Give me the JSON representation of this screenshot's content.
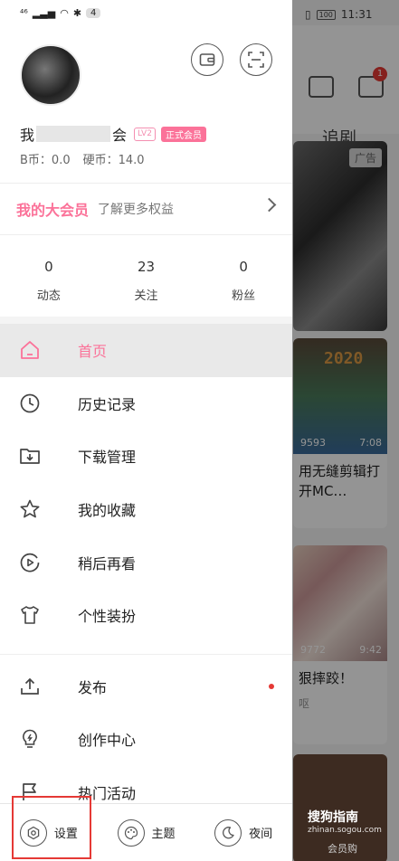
{
  "statusbar": {
    "signal": "⁴⁶",
    "notif_count": "4",
    "battery": "100",
    "time": "11:31"
  },
  "background": {
    "tab_label": "追剧",
    "mail_badge": "1",
    "ad_label": "广告",
    "card2": {
      "overlay_text": "2020",
      "views": "9593",
      "duration": "7:08",
      "title": "用无缝剪辑打开MC…"
    },
    "card3": {
      "views": "9772",
      "duration": "9:42",
      "title": "狠摔跤！",
      "sub": "呕"
    },
    "footer_label": "会员购",
    "watermark": "搜狗指南",
    "watermark_url": "zhinan.sogou.com"
  },
  "profile": {
    "name_start": "我",
    "name_end": "会",
    "level": "LV2",
    "vip_badge": "正式会员",
    "bcoin": "B币：0.0",
    "hardcoin": "硬币：14.0"
  },
  "vip_banner": {
    "title": "我的大会员",
    "subtitle": "了解更多权益"
  },
  "stats": [
    {
      "value": "0",
      "label": "动态"
    },
    {
      "value": "23",
      "label": "关注"
    },
    {
      "value": "0",
      "label": "粉丝"
    }
  ],
  "menu": {
    "home": "首页",
    "history": "历史记录",
    "downloads": "下载管理",
    "favorites": "我的收藏",
    "watch_later": "稍后再看",
    "theme_store": "个性装扮",
    "publish": "发布",
    "creator_center": "创作中心",
    "hot_events": "热门活动"
  },
  "bottom": {
    "settings": "设置",
    "theme": "主题",
    "night": "夜间"
  },
  "colors": {
    "accent": "#fb7299",
    "highlight": "#e53935"
  }
}
